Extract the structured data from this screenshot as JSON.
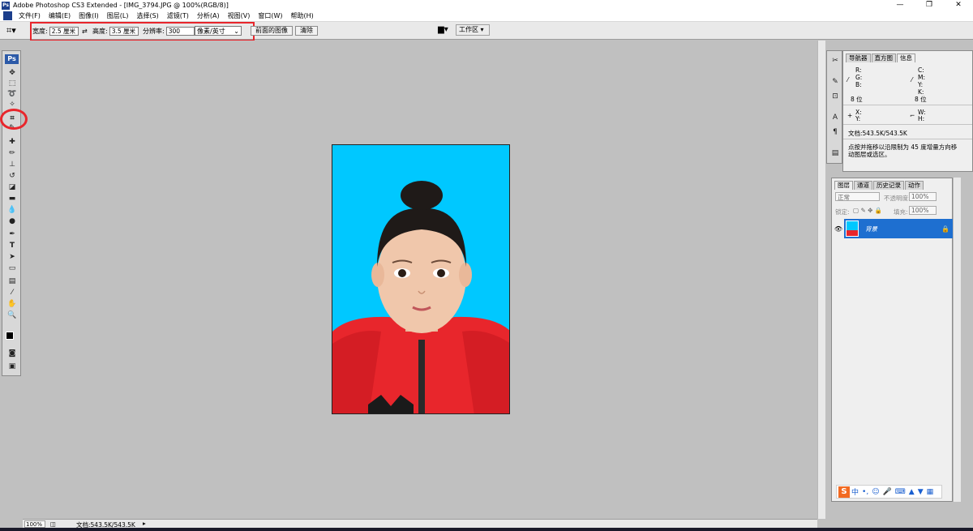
{
  "window": {
    "title": "Adobe Photoshop CS3 Extended - [IMG_3794.JPG @ 100%(RGB/8)]",
    "minimize": "—",
    "restore": "❐",
    "close": "✕"
  },
  "menu": [
    "文件(F)",
    "编辑(E)",
    "图像(I)",
    "图层(L)",
    "选择(S)",
    "滤镜(T)",
    "分析(A)",
    "视图(V)",
    "窗口(W)",
    "帮助(H)"
  ],
  "options": {
    "width_label": "宽度:",
    "width_value": "2.5 厘米",
    "swap_icon": "⇄",
    "height_label": "高度:",
    "height_value": "3.5 厘米",
    "resolution_label": "分辨率:",
    "resolution_value": "300",
    "unit_select": "像素/英寸",
    "front_image_button": "前面的图像",
    "clear_button": "清除",
    "workspace_label": "工作区 ▾"
  },
  "toolbox": {
    "ps_logo": "Ps"
  },
  "info_panel": {
    "tabs": [
      "导航器",
      "直方图",
      "信息"
    ],
    "active_tab": "信息",
    "rgb": [
      "R:",
      "G:",
      "B:"
    ],
    "cmyk": [
      "C:",
      "M:",
      "Y:",
      "K:"
    ],
    "bits_left": "8 位",
    "bits_right": "8 位",
    "xy": [
      "X:",
      "Y:"
    ],
    "wh": [
      "W:",
      "H:"
    ],
    "doc_size": "文档:543.5K/543.5K",
    "hint": "点按并拖移以沿限制为 45 度增量方向移动图层或选区。"
  },
  "layers_panel": {
    "tabs": [
      "图层",
      "通道",
      "历史记录",
      "动作"
    ],
    "blend_mode": "正常",
    "opacity_label": "不透明度:",
    "opacity_value": "100%",
    "lock_label": "锁定:",
    "fill_label": "填充:",
    "fill_value": "100%",
    "layer_name": "背景"
  },
  "status": {
    "zoom": "100%",
    "doc": "文档:543.5K/543.5K"
  },
  "ime": {
    "logo": "S",
    "text": "中"
  },
  "colors": {
    "photo_bg": "#00c8ff",
    "jacket": "#e8262c",
    "highlight": "#e8262c",
    "layer_selected": "#1e6fd0"
  }
}
